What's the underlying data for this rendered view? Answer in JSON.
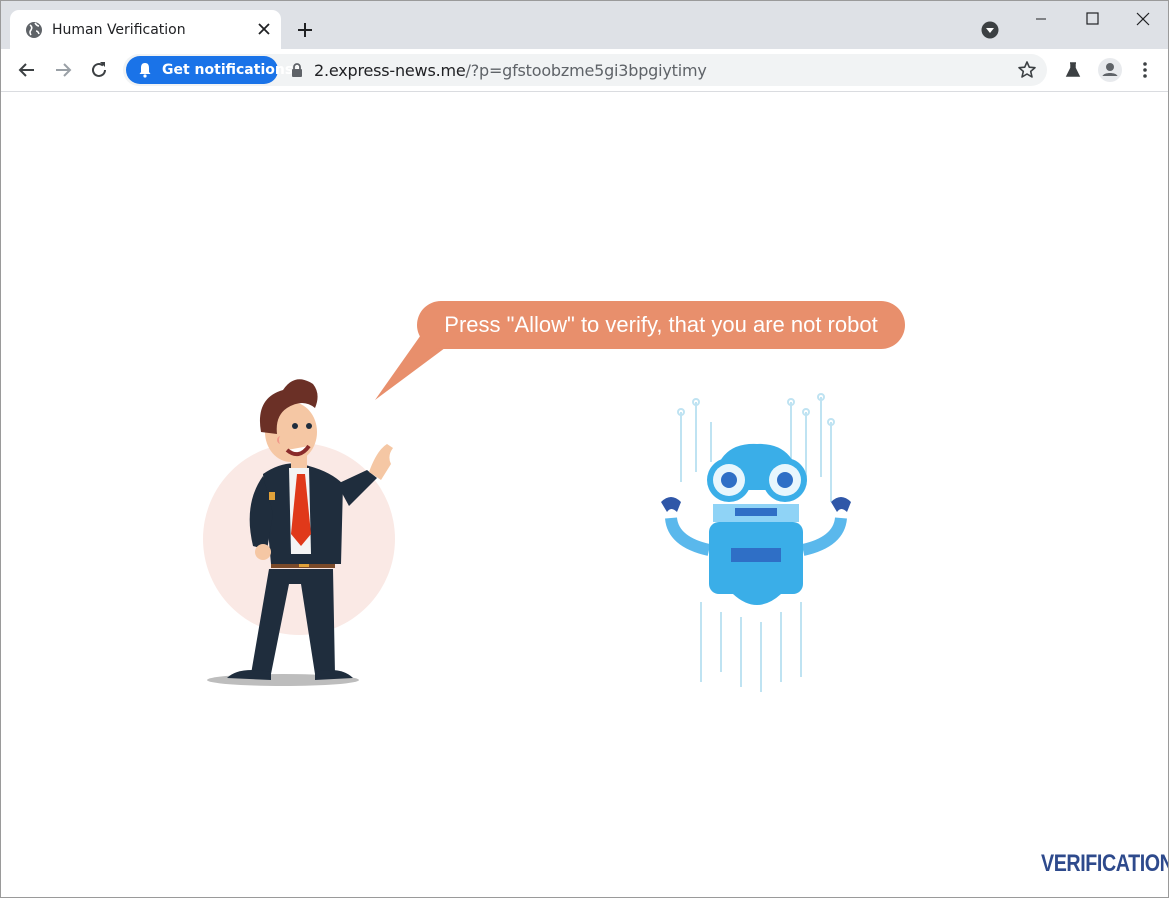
{
  "tab": {
    "title": "Human Verification"
  },
  "toolbar": {
    "notification_chip": "Get notifications?",
    "url_host": "2.express-news.me",
    "url_path": "/?p=gfstoobzme5gi3bpgiytimy"
  },
  "page": {
    "bubble_text": "Press \"Allow\" to verify, that you are not robot",
    "brand": "VERIFICATION"
  },
  "icons": [
    "globe-icon",
    "close-icon",
    "plus-icon",
    "chevron-down-icon",
    "minimize-icon",
    "maximize-icon",
    "close-icon",
    "back-icon",
    "forward-icon",
    "reload-icon",
    "bell-icon",
    "lock-icon",
    "star-icon",
    "labs-icon",
    "account-icon",
    "menu-icon"
  ],
  "colors": {
    "accent": "#1a73e8",
    "bubble": "#e88f6c",
    "brand": "#2e4a8c",
    "tabstrip": "#dee1e6"
  }
}
